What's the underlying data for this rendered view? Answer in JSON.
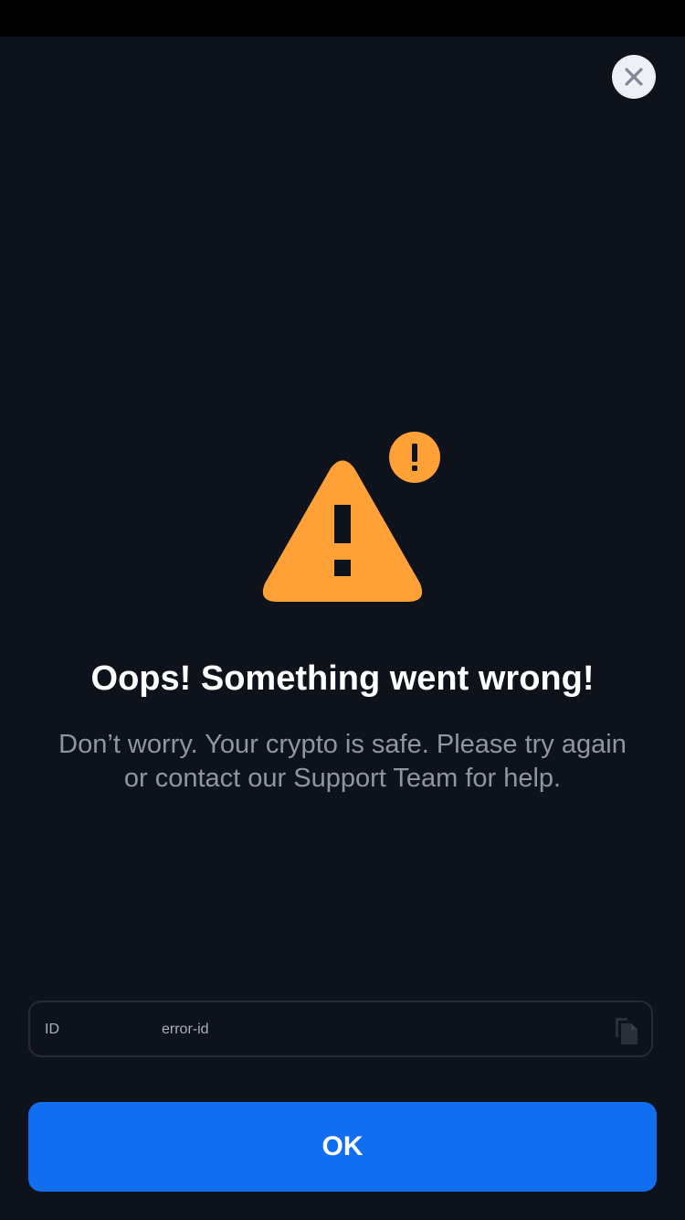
{
  "colors": {
    "background": "#0e121b",
    "accent_warning": "#ffa136",
    "primary_button": "#116ef0",
    "close_button_bg": "#eef0f5"
  },
  "header": {
    "close_icon": "close-icon"
  },
  "illustration": {
    "icon": "warning-triangle-icon",
    "badge_icon": "exclamation-badge-icon"
  },
  "message": {
    "title": "Oops! Something went wrong!",
    "body": "Don’t worry. Your crypto is safe. Please try again or contact our Support Team for help."
  },
  "id_field": {
    "label": "ID",
    "value": "error-id",
    "copy_icon": "copy-icon"
  },
  "actions": {
    "ok_label": "OK"
  }
}
